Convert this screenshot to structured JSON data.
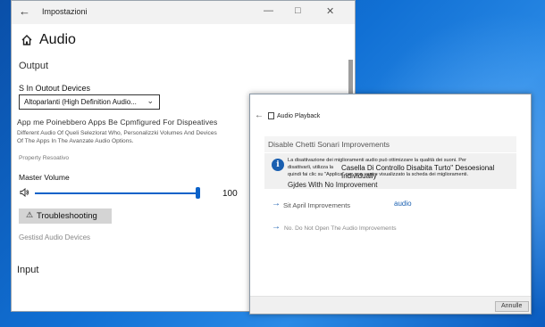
{
  "settings_window": {
    "title": "Impostazioni",
    "back_glyph": "←",
    "minimize_glyph": "—",
    "maximize_glyph": "□",
    "close_glyph": "✕",
    "page_title": "Audio",
    "output_heading": "Output",
    "devices_label": "S In Outout Devices",
    "device_value": "Altoparlanti (High Definition Audio...",
    "apps_heading": "App me Poinebbero Apps Be Cpmfigured For Dispeatives",
    "apps_description_1": "Different Audio Of Queli Selezlorat Who, Personalizzki Volumes And Devices",
    "apps_description_2": "Of The Apps In The Avanzate Audio Options.",
    "properties_link": "Property Resoativo",
    "master_volume_label": "Master Volume",
    "volume_value": "100",
    "volume_level": 0.98,
    "troubleshoot_label": "Troubleshooting",
    "manage_devices_link": "Gestisd Audio Devices",
    "input_heading": "Input",
    "icons": [
      "back-arrow-icon",
      "home-icon",
      "speaker-icon",
      "warning-icon",
      "chevron-down-icon"
    ]
  },
  "dialog": {
    "title": "Audio Playback",
    "subtitle": "Disable Chetti Sonari Improvements",
    "info_line_1": "La disattivazione dei miglioramenti audio può ottimizzare la qualità dei suoni. Per",
    "info_line_2": "disattivarli, utilizza la",
    "info_overlay": "Casella Di Controllo Disabita Turto\" Desoesional Individually",
    "info_line_3": "quindi fai clic su \"Applica\" per non venire visualizzato la scheda dei miglioramenti.",
    "info_line_4": "Gjdes With No Improvement",
    "option_1": "Sit April Improvements",
    "option_1_extra": "audio",
    "option_2": "No. Do Not Open The Audio Improvements",
    "cancel_label": "Annulle",
    "icons": [
      "back-arrow-icon",
      "app-icon",
      "info-icon",
      "arrow-right-icon"
    ]
  },
  "colors": {
    "accent": "#0b62c9",
    "info_icon": "#1a5fb0",
    "desktop_background": "#1170d4"
  }
}
